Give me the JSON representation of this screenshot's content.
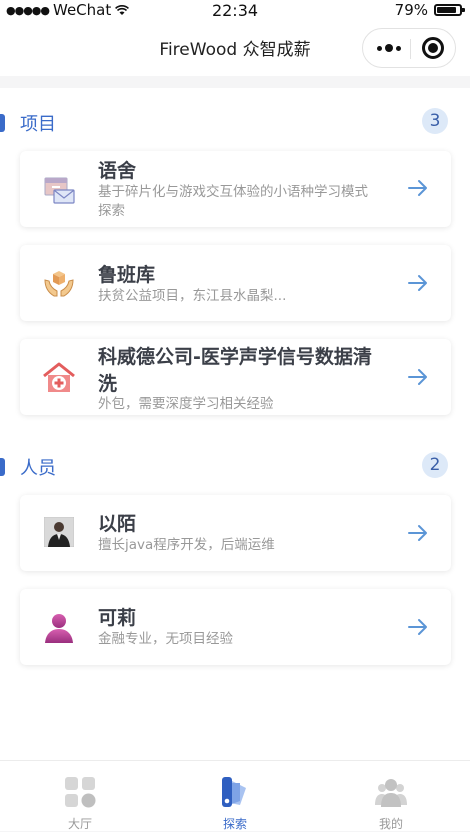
{
  "status_bar": {
    "carrier": "WeChat",
    "time": "22:34",
    "battery": "79%"
  },
  "nav": {
    "title": "FireWood 众智成薪"
  },
  "sections": [
    {
      "label": "项目",
      "count": "3",
      "items": [
        {
          "title": "语舍",
          "subtitle_line1": "基于碎片化与游戏交互体验的小语种学习模式",
          "subtitle_line2": "探索",
          "icon": "mail-box-icon"
        },
        {
          "title": "鲁班库",
          "subtitle": "扶贫公益项目，东江县水晶梨...",
          "icon": "hands-box-icon"
        },
        {
          "title_line1": "科威德公司-医学声学信号数据清",
          "title_line2": "洗",
          "subtitle": "外包，需要深度学习相关经验",
          "icon": "hospital-icon"
        }
      ]
    },
    {
      "label": "人员",
      "count": "2",
      "items": [
        {
          "title": "以陌",
          "subtitle": "擅长java程序开发，后端运维",
          "icon": "avatar-photo"
        },
        {
          "title": "可莉",
          "subtitle": "金融专业，无项目经验",
          "icon": "person-icon"
        }
      ]
    }
  ],
  "tabbar": [
    {
      "label": "大厅",
      "icon": "grid-icon",
      "active": false
    },
    {
      "label": "探索",
      "icon": "palette-icon",
      "active": true
    },
    {
      "label": "我的",
      "icon": "people-icon",
      "active": false
    }
  ],
  "colors": {
    "accent": "#3a6bc9",
    "arrow": "#5b95d6",
    "badge_bg": "#dde9f8"
  }
}
